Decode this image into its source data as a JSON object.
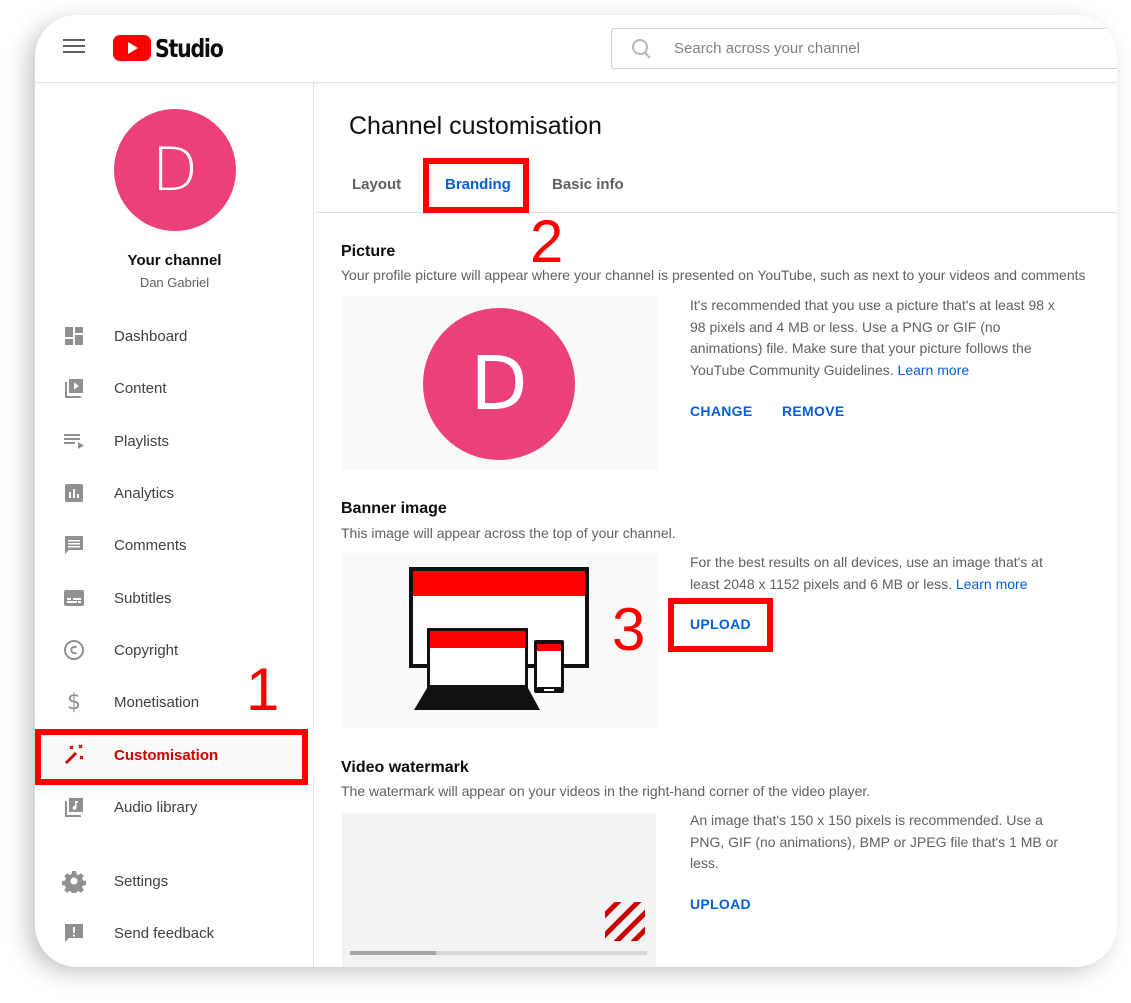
{
  "header": {
    "app_name": "Studio",
    "search_placeholder": "Search across your channel"
  },
  "sidebar": {
    "avatar_initial": "D",
    "avatar_color": "#ec407a",
    "your_channel_label": "Your channel",
    "channel_name": "Dan Gabriel",
    "items": [
      {
        "label": "Dashboard",
        "icon": "dashboard-icon"
      },
      {
        "label": "Content",
        "icon": "content-icon"
      },
      {
        "label": "Playlists",
        "icon": "playlists-icon"
      },
      {
        "label": "Analytics",
        "icon": "analytics-icon"
      },
      {
        "label": "Comments",
        "icon": "comments-icon"
      },
      {
        "label": "Subtitles",
        "icon": "subtitles-icon"
      },
      {
        "label": "Copyright",
        "icon": "copyright-icon"
      },
      {
        "label": "Monetisation",
        "icon": "dollar-icon"
      },
      {
        "label": "Customisation",
        "icon": "magic-wand-icon",
        "active": true
      },
      {
        "label": "Audio library",
        "icon": "audio-library-icon"
      },
      {
        "label": "Settings",
        "icon": "gear-icon"
      },
      {
        "label": "Send feedback",
        "icon": "feedback-icon"
      }
    ]
  },
  "main": {
    "title": "Channel customisation",
    "tabs": [
      {
        "label": "Layout"
      },
      {
        "label": "Branding",
        "active": true
      },
      {
        "label": "Basic info"
      }
    ],
    "picture": {
      "title": "Picture",
      "description": "Your profile picture will appear where your channel is presented on YouTube, such as next to your videos and comments",
      "avatar_initial": "D",
      "info": "It's recommended that you use a picture that's at least 98 x 98 pixels and 4 MB or less. Use a PNG or GIF (no animations) file. Make sure that your picture follows the YouTube Community Guidelines.",
      "learn_more": "Learn more",
      "change_label": "CHANGE",
      "remove_label": "REMOVE"
    },
    "banner": {
      "title": "Banner image",
      "description": "This image will appear across the top of your channel.",
      "info": "For the best results on all devices, use an image that's at least 2048 x 1152 pixels and 6 MB or less.",
      "learn_more": "Learn more",
      "upload_label": "UPLOAD"
    },
    "watermark": {
      "title": "Video watermark",
      "description": "The watermark will appear on your videos in the right-hand corner of the video player.",
      "info": "An image that's 150 x 150 pixels is recommended. Use a PNG, GIF (no animations), BMP or JPEG file that's 1 MB or less.",
      "upload_label": "UPLOAD",
      "player_progress_fraction": 0.29
    }
  },
  "annotations": {
    "step1": "1",
    "step2": "2",
    "step3": "3",
    "color": "#ff0000"
  },
  "colors": {
    "accent_blue": "#065fd4",
    "brand_red": "#ff0000",
    "active_red": "#cc0000"
  }
}
